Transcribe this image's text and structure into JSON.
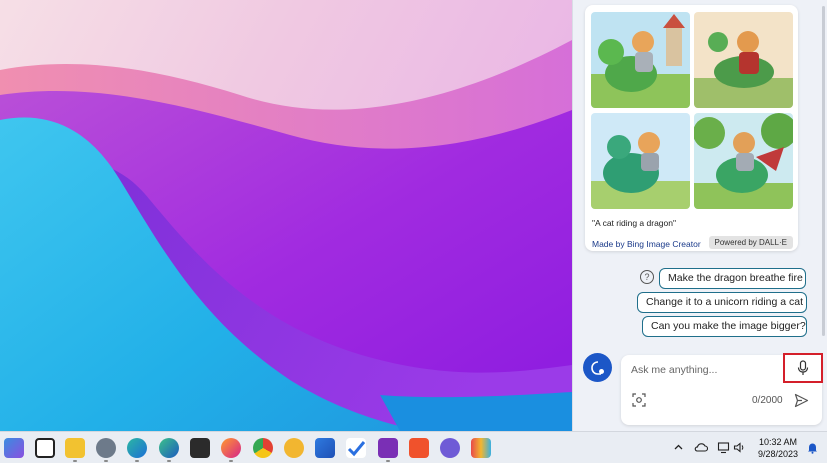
{
  "copilot": {
    "image_card": {
      "caption": "\"A cat riding a dragon\"",
      "made_by": "Made by Bing Image Creator",
      "powered_by": "Powered by DALL·E"
    },
    "suggestions": [
      "Make the dragon breathe fire",
      "Change it to a unicorn riding a cat",
      "Can you make the image bigger?"
    ],
    "input": {
      "placeholder": "Ask me anything...",
      "counter": "0/2000"
    }
  },
  "taskbar": {
    "apps": [
      "copilot-preview",
      "task-view",
      "file-explorer",
      "settings",
      "edge",
      "edge-canary",
      "terminal",
      "firefox",
      "chrome",
      "chrome-canary",
      "microsoft-store",
      "todo",
      "onenote",
      "brave",
      "teams-preview",
      "app"
    ],
    "clock": {
      "time": "10:32 AM",
      "date": "9/28/2023"
    }
  }
}
